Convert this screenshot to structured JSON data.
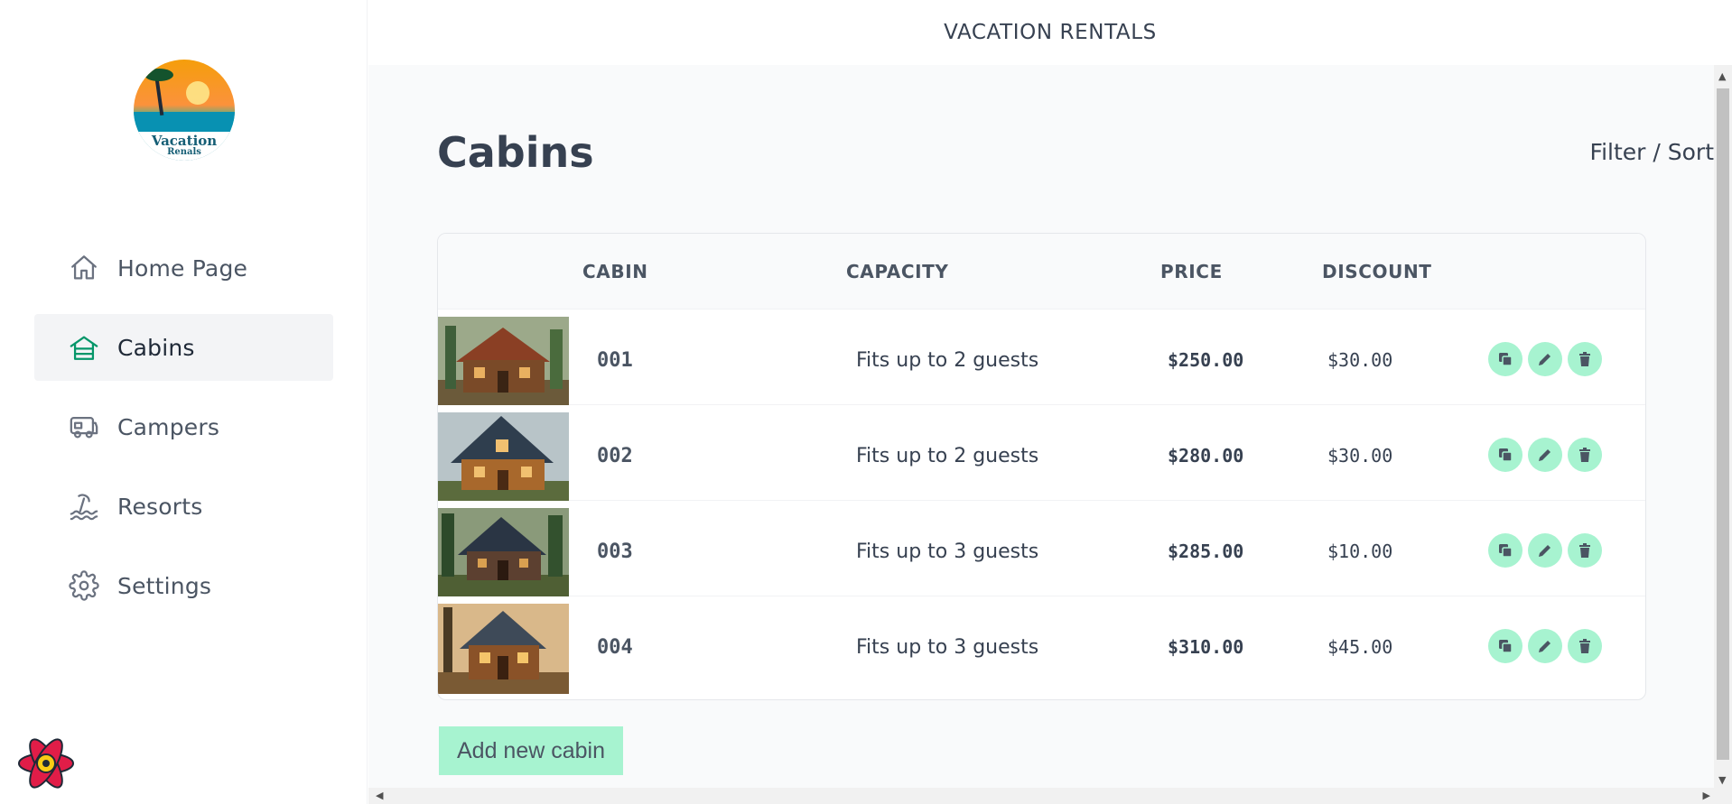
{
  "sidebar": {
    "logo": {
      "line1": "Vacation",
      "line2": "Renals"
    },
    "items": [
      {
        "label": "Home Page",
        "icon": "home-icon",
        "active": false
      },
      {
        "label": "Cabins",
        "icon": "cabin-icon",
        "active": true
      },
      {
        "label": "Campers",
        "icon": "camper-icon",
        "active": false
      },
      {
        "label": "Resorts",
        "icon": "resort-icon",
        "active": false
      },
      {
        "label": "Settings",
        "icon": "gear-icon",
        "active": false
      }
    ]
  },
  "header": {
    "title": "VACATION RENTALS"
  },
  "main": {
    "title": "Cabins",
    "filter_sort": "Filter / Sort",
    "columns": [
      "CABIN",
      "CAPACITY",
      "PRICE",
      "DISCOUNT"
    ],
    "rows": [
      {
        "name": "001",
        "capacity": "Fits up to 2 guests",
        "price": "$250.00",
        "discount": "$30.00"
      },
      {
        "name": "002",
        "capacity": "Fits up to 2 guests",
        "price": "$280.00",
        "discount": "$30.00"
      },
      {
        "name": "003",
        "capacity": "Fits up to 3 guests",
        "price": "$285.00",
        "discount": "$10.00"
      },
      {
        "name": "004",
        "capacity": "Fits up to 3 guests",
        "price": "$310.00",
        "discount": "$45.00"
      }
    ],
    "row_actions": [
      "duplicate-icon",
      "edit-icon",
      "delete-icon"
    ],
    "add_button": "Add new cabin"
  },
  "colors": {
    "accent": "#059669",
    "action_bg": "#a7f3d0",
    "page_bg": "#f9fafb"
  }
}
